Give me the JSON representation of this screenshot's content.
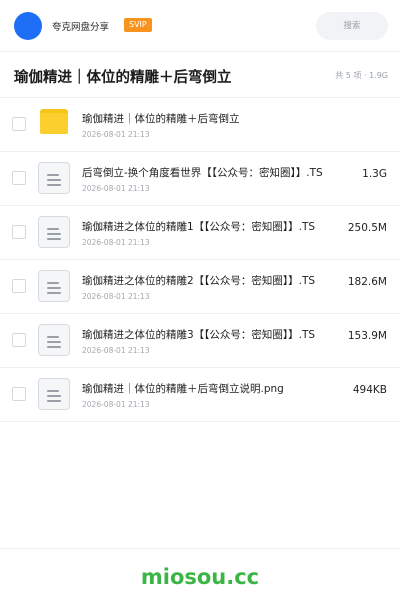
{
  "app": {
    "brand": "夸克网盘分享",
    "badge": "SVIP",
    "search_placeholder": "搜索"
  },
  "folder": {
    "title": "瑜伽精进｜体位的精雕＋后弯倒立",
    "meta": "共 5 项 · 1.9G"
  },
  "files": [
    {
      "name": "瑜伽精进｜体位的精雕＋后弯倒立",
      "date": "2026-08-01 21:13",
      "size": "",
      "icon": "folder-icon"
    },
    {
      "name": "后弯倒立-换个角度看世界【【公众号：密知圈】】.TS",
      "date": "2026-08-01 21:13",
      "size": "1.3G",
      "icon": "file-icon"
    },
    {
      "name": "瑜伽精进之体位的精雕1【【公众号：密知圈】】.TS",
      "date": "2026-08-01 21:13",
      "size": "250.5M",
      "icon": "file-icon"
    },
    {
      "name": "瑜伽精进之体位的精雕2【【公众号：密知圈】】.TS",
      "date": "2026-08-01 21:13",
      "size": "182.6M",
      "icon": "file-icon"
    },
    {
      "name": "瑜伽精进之体位的精雕3【【公众号：密知圈】】.TS",
      "date": "2026-08-01 21:13",
      "size": "153.9M",
      "icon": "file-icon"
    },
    {
      "name": "瑜伽精进｜体位的精雕＋后弯倒立说明.png",
      "date": "2026-08-01 21:13",
      "size": "494KB",
      "icon": "file-icon"
    }
  ],
  "footer": {
    "watermark": "miosou.cc"
  },
  "colors": {
    "accent": "#1e6ff5",
    "badge": "#f7931e",
    "folder": "#fbcf2d",
    "watermark": "#3bb543"
  }
}
